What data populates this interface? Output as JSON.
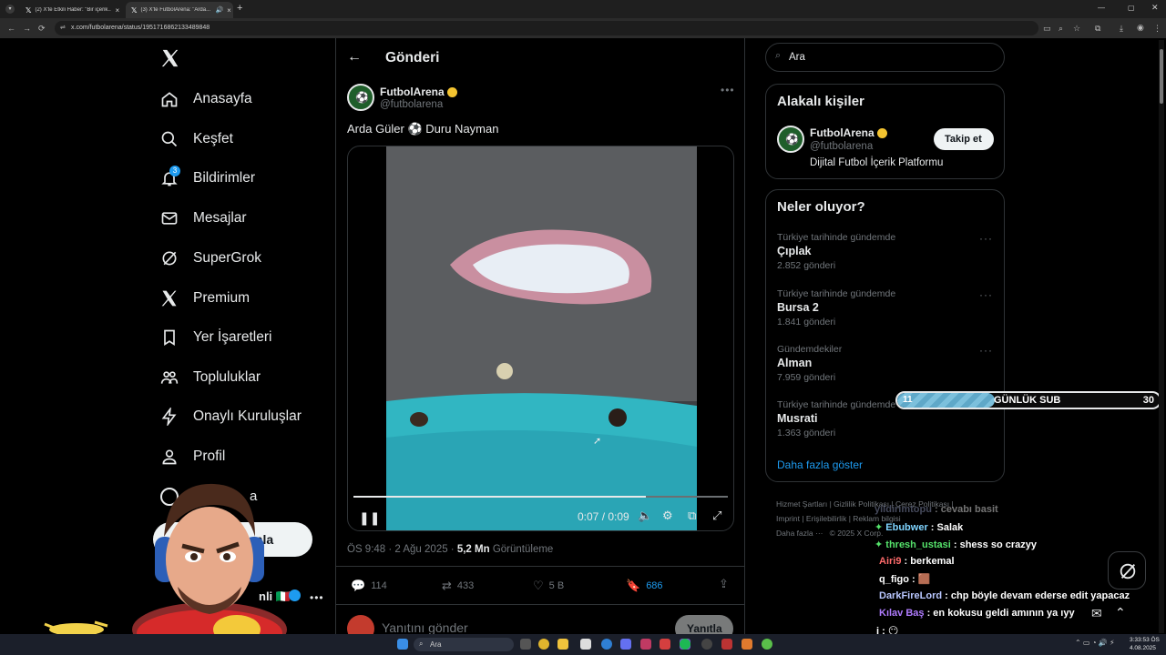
{
  "browser": {
    "tabs": [
      {
        "label": "(2) X'te Etkili Haber: \"Bir içerik...",
        "close": "×"
      },
      {
        "label": "(3) X'te FutbolArena: \"Arda...",
        "close": "×"
      }
    ],
    "new_tab": "+",
    "url": "x.com/futbolarena/status/1951716862133489848"
  },
  "nav": {
    "items": [
      {
        "label": "Anasayfa",
        "icon": "home-icon"
      },
      {
        "label": "Keşfet",
        "icon": "search-icon"
      },
      {
        "label": "Bildirimler",
        "icon": "bell-icon",
        "badge": "3"
      },
      {
        "label": "Mesajlar",
        "icon": "mail-icon"
      },
      {
        "label": "SuperGrok",
        "icon": "grok-icon"
      },
      {
        "label": "Premium",
        "icon": "x-logo-icon"
      },
      {
        "label": "Yer İşaretleri",
        "icon": "bookmark-icon"
      },
      {
        "label": "Topluluklar",
        "icon": "people-icon"
      },
      {
        "label": "Onaylı Kuruluşlar",
        "icon": "lightning-icon"
      },
      {
        "label": "Profil",
        "icon": "person-icon"
      }
    ],
    "more_label_fragment": "a",
    "post_button_fragment": "ınla",
    "account_fragment": "nli 🇮🇹"
  },
  "post": {
    "header_title": "Gönderi",
    "author_name": "FutbolArena",
    "author_handle": "@futbolarena",
    "text": "Arda Güler ⚽ Duru Nayman",
    "video_time": "0:07 / 0:09",
    "video_progress": 0.78,
    "timestamp": "ÖS 9:48 · 2 Ağu 2025 · ",
    "views_value": "5,2 Mn",
    "views_label": " Görüntüleme",
    "replies": "114",
    "reposts": "433",
    "likes": "5 B",
    "bookmarks": "686",
    "reply_placeholder": "Yanıtını gönder",
    "reply_button": "Yanıtla"
  },
  "search": {
    "placeholder": "Ara"
  },
  "related": {
    "title": "Alakalı kişiler",
    "name": "FutbolArena",
    "handle": "@futbolarena",
    "bio": "Dijital Futbol İçerik Platformu",
    "follow_button": "Takip et"
  },
  "trends": {
    "title": "Neler oluyor?",
    "items": [
      {
        "context": "Türkiye tarihinde gündemde",
        "name": "Çıplak",
        "count": "2.852 gönderi"
      },
      {
        "context": "Türkiye tarihinde gündemde",
        "name": "Bursa 2",
        "count": "1.841 gönderi"
      },
      {
        "context": "Gündemdekiler",
        "name": "Alman",
        "count": "7.959 gönderi"
      },
      {
        "context": "Türkiye tarihinde gündemde",
        "name": "Musrati",
        "count": "1.363 gönderi"
      }
    ],
    "show_more": "Daha fazla göster"
  },
  "footer": {
    "links": [
      "Hizmet Şartları",
      "Gizlilik Politikası",
      "Çerez Politikası",
      "Imprint",
      "Erişilebilirlik",
      "Reklam bilgisi"
    ],
    "more": "Daha fazla ···",
    "copyright": "© 2025 X Corp."
  },
  "overlay": {
    "sub_current": "11",
    "sub_label": "GÜNLÜK SUB",
    "sub_goal": "30",
    "sub_fraction": 0.37
  },
  "chat": [
    {
      "user": "yildirimtopu",
      "msg": " : cevabı basit",
      "color": "#9aa3c9"
    },
    {
      "user": "Ebubwer",
      "msg": " : Salak",
      "color": "#7fd4ff"
    },
    {
      "user": "thresh_ustasi",
      "msg": " : shess so crazyy",
      "color": "#55e36b"
    },
    {
      "user": "Airi9",
      "msg": " : berkemal",
      "color": "#ff6b6b"
    },
    {
      "user": "q_figo",
      "msg": " : 🟫",
      "color": "#ffffff"
    },
    {
      "user": "DarkFireLord",
      "msg": " : chp böyle devam ederse edit yapacaz",
      "color": "#b9c7ff"
    },
    {
      "user": "Kılav Baş",
      "msg": " : en kokusu geldi amının ya ıyy",
      "color": "#b07cff"
    },
    {
      "user": "i",
      "msg": " : 😶",
      "color": "#ffffff"
    }
  ],
  "taskbar": {
    "search_placeholder": "Ara",
    "time": "3:33:53 ÖS",
    "date": "4.08.2025"
  },
  "colors": {
    "accent": "#1d9bf0",
    "verified": "#f4c430",
    "bg": "#000000",
    "border": "#2f3336",
    "muted": "#71767b"
  }
}
